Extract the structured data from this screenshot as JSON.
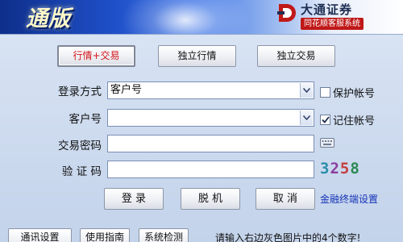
{
  "app": {
    "logo_text": "通版"
  },
  "broker": {
    "name": "大通证券",
    "subtitle": "同花顺客服系统"
  },
  "modes": [
    {
      "label": "行情+交易",
      "active": true
    },
    {
      "label": "独立行情",
      "active": false
    },
    {
      "label": "独立交易",
      "active": false
    }
  ],
  "form": {
    "login_method": {
      "label": "登录方式",
      "value": "客户号"
    },
    "account": {
      "label": "客户号",
      "value": ""
    },
    "trade_password": {
      "label": "交易密码",
      "value": ""
    },
    "captcha_input": {
      "label": "验 证 码",
      "value": ""
    },
    "captcha_digits": [
      "3",
      "2",
      "5",
      "8"
    ]
  },
  "options": {
    "protect_account": {
      "label": "保护帐号",
      "checked": false
    },
    "remember_account": {
      "label": "记住帐号",
      "checked": true
    }
  },
  "actions": {
    "login": "登 录",
    "offline": "脱 机",
    "cancel": "取 消"
  },
  "links": {
    "terminal_settings": "金融终端设置"
  },
  "footer": {
    "buttons": [
      "通讯设置",
      "使用指南",
      "系统检测"
    ],
    "hint": "请输入右边灰色图片中的4个数字!"
  },
  "colors": {
    "active_mode_text": "#d3161a",
    "link": "#1633b8",
    "brand_red": "#c01818"
  },
  "icons": [
    "chevron-down-icon",
    "keyboard-icon",
    "checkmark-icon",
    "broker-logo-icon"
  ]
}
